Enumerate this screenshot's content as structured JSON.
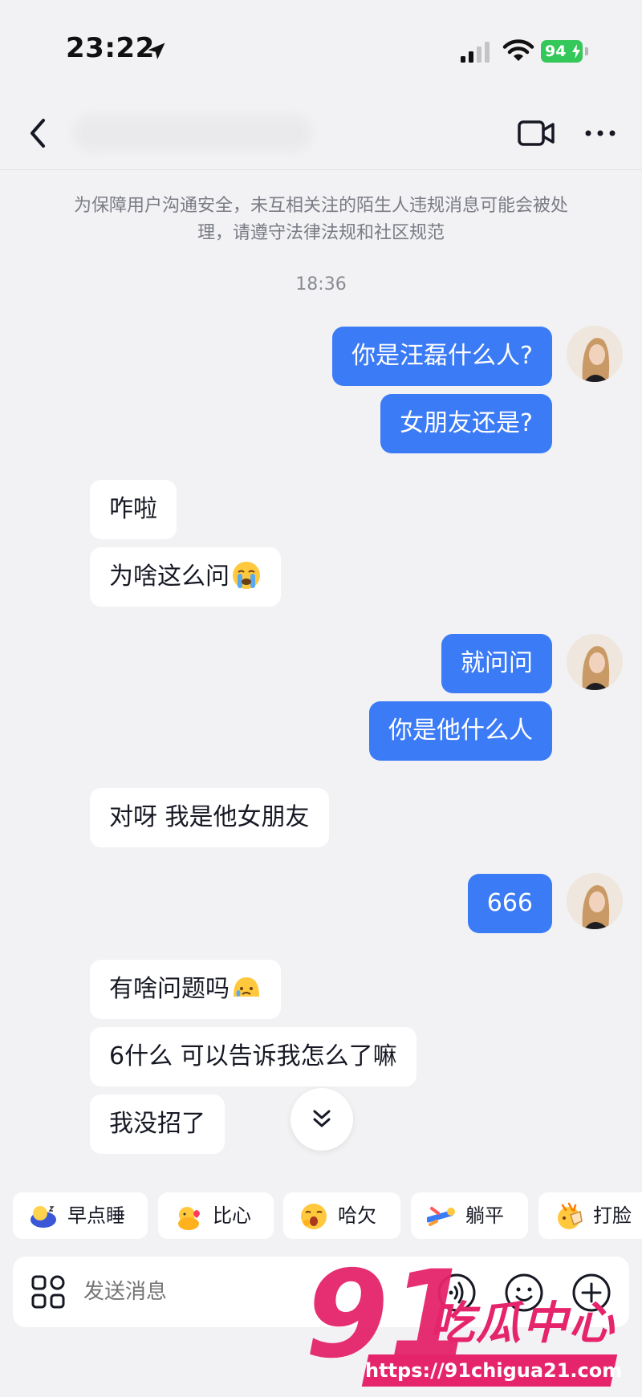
{
  "status_bar": {
    "time": "23:22",
    "battery": "94"
  },
  "notice": "为保障用户沟通安全，未互相关注的陌生人违规消息可能会被处理，请遵守法律法规和社区规范",
  "timestamp": "18:36",
  "messages": [
    {
      "side": "out",
      "text": "你是汪磊什么人?"
    },
    {
      "side": "out",
      "text": "女朋友还是?"
    },
    {
      "side": "in",
      "text": "咋啦"
    },
    {
      "side": "in",
      "text": "为啥这么问",
      "emoji": "loudly-crying-face-icon"
    },
    {
      "side": "out",
      "text": "就问问"
    },
    {
      "side": "out",
      "text": "你是他什么人"
    },
    {
      "side": "in",
      "text": "对呀 我是他女朋友"
    },
    {
      "side": "out",
      "text": "666"
    },
    {
      "side": "in",
      "text": "有啥问题吗",
      "emoji": "sad-face-icon"
    },
    {
      "side": "in",
      "text": "6什么 可以告诉我怎么了嘛"
    },
    {
      "side": "in",
      "text": "我没招了"
    }
  ],
  "quick_replies": [
    {
      "label": "早点睡",
      "icon": "moon-icon"
    },
    {
      "label": "比心",
      "icon": "heart-duck-icon"
    },
    {
      "label": "哈欠",
      "icon": "yawn-icon"
    },
    {
      "label": "躺平",
      "icon": "lie-flat-icon"
    },
    {
      "label": "打脸",
      "icon": "slap-icon"
    }
  ],
  "input": {
    "placeholder": "发送消息"
  },
  "watermark": {
    "brand": "吃瓜中心",
    "number": "91",
    "url": "https://91chigua21.com"
  },
  "colors": {
    "outgoing_bubble": "#3c7bf6",
    "incoming_bubble": "#ffffff",
    "background": "#f2f2f4",
    "watermark": "#e5246b"
  }
}
